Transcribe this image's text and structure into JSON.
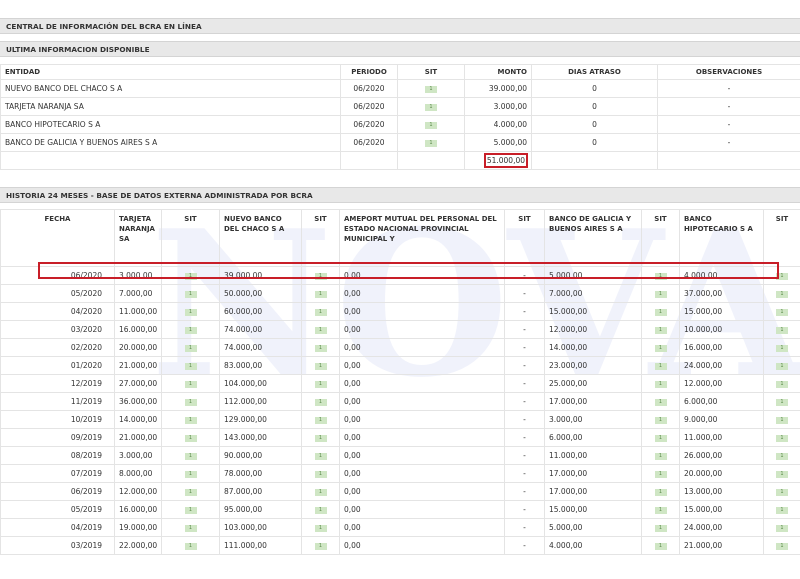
{
  "header_bar": "CENTRAL DE INFORMACIÓN DEL BCRA EN LÍNEA",
  "section1": {
    "title": "ULTIMA INFORMACION DISPONIBLE",
    "columns": [
      "ENTIDAD",
      "PERIODO",
      "SIT",
      "MONTO",
      "DIAS ATRASO",
      "OBSERVACIONES"
    ],
    "rows": [
      {
        "entidad": "NUEVO BANCO DEL CHACO S A",
        "periodo": "06/2020",
        "sit": "1",
        "monto": "39.000,00",
        "dias": "0",
        "obs": "-"
      },
      {
        "entidad": "TARJETA NARANJA SA",
        "periodo": "06/2020",
        "sit": "1",
        "monto": "3.000,00",
        "dias": "0",
        "obs": "-"
      },
      {
        "entidad": "BANCO HIPOTECARIO S A",
        "periodo": "06/2020",
        "sit": "1",
        "monto": "4.000,00",
        "dias": "0",
        "obs": "-"
      },
      {
        "entidad": "BANCO DE GALICIA Y BUENOS AIRES S A",
        "periodo": "06/2020",
        "sit": "1",
        "monto": "5.000,00",
        "dias": "0",
        "obs": "-"
      }
    ],
    "total": "51.000,00"
  },
  "section2": {
    "title": "HISTORIA 24 MESES - BASE DE DATOS EXTERNA ADMINISTRADA POR BCRA",
    "columns": [
      "FECHA",
      "TARJETA NARANJA SA",
      "SIT",
      "NUEVO BANCO DEL CHACO S A",
      "SIT",
      "AMEPORT MUTUAL DEL PERSONAL DEL ESTADO NACIONAL PROVINCIAL MUNICIPAL Y",
      "SIT",
      "BANCO DE GALICIA Y BUENOS AIRES S A",
      "SIT",
      "BANCO HIPOTECARIO S A",
      "SIT"
    ],
    "rows": [
      {
        "fecha": "06/2020",
        "tn": "3.000,00",
        "nbc": "39.000,00",
        "am": "0,00",
        "am_sit": "-",
        "gal": "5.000,00",
        "hip": "4.000,00"
      },
      {
        "fecha": "05/2020",
        "tn": "7.000,00",
        "nbc": "50.000,00",
        "am": "0,00",
        "am_sit": "-",
        "gal": "7.000,00",
        "hip": "37.000,00"
      },
      {
        "fecha": "04/2020",
        "tn": "11.000,00",
        "nbc": "60.000,00",
        "am": "0,00",
        "am_sit": "-",
        "gal": "15.000,00",
        "hip": "15.000,00"
      },
      {
        "fecha": "03/2020",
        "tn": "16.000,00",
        "nbc": "74.000,00",
        "am": "0,00",
        "am_sit": "-",
        "gal": "12.000,00",
        "hip": "10.000,00"
      },
      {
        "fecha": "02/2020",
        "tn": "20.000,00",
        "nbc": "74.000,00",
        "am": "0,00",
        "am_sit": "-",
        "gal": "14.000,00",
        "hip": "16.000,00"
      },
      {
        "fecha": "01/2020",
        "tn": "21.000,00",
        "nbc": "83.000,00",
        "am": "0,00",
        "am_sit": "-",
        "gal": "23.000,00",
        "hip": "24.000,00"
      },
      {
        "fecha": "12/2019",
        "tn": "27.000,00",
        "nbc": "104.000,00",
        "am": "0,00",
        "am_sit": "-",
        "gal": "25.000,00",
        "hip": "12.000,00"
      },
      {
        "fecha": "11/2019",
        "tn": "36.000,00",
        "nbc": "112.000,00",
        "am": "0,00",
        "am_sit": "-",
        "gal": "17.000,00",
        "hip": "6.000,00"
      },
      {
        "fecha": "10/2019",
        "tn": "14.000,00",
        "nbc": "129.000,00",
        "am": "0,00",
        "am_sit": "-",
        "gal": "3.000,00",
        "hip": "9.000,00"
      },
      {
        "fecha": "09/2019",
        "tn": "21.000,00",
        "nbc": "143.000,00",
        "am": "0,00",
        "am_sit": "-",
        "gal": "6.000,00",
        "hip": "11.000,00"
      },
      {
        "fecha": "08/2019",
        "tn": "3.000,00",
        "nbc": "90.000,00",
        "am": "0,00",
        "am_sit": "-",
        "gal": "11.000,00",
        "hip": "26.000,00"
      },
      {
        "fecha": "07/2019",
        "tn": "8.000,00",
        "nbc": "78.000,00",
        "am": "0,00",
        "am_sit": "-",
        "gal": "17.000,00",
        "hip": "20.000,00"
      },
      {
        "fecha": "06/2019",
        "tn": "12.000,00",
        "nbc": "87.000,00",
        "am": "0,00",
        "am_sit": "-",
        "gal": "17.000,00",
        "hip": "13.000,00"
      },
      {
        "fecha": "05/2019",
        "tn": "16.000,00",
        "nbc": "95.000,00",
        "am": "0,00",
        "am_sit": "-",
        "gal": "15.000,00",
        "hip": "15.000,00"
      },
      {
        "fecha": "04/2019",
        "tn": "19.000,00",
        "nbc": "103.000,00",
        "am": "0,00",
        "am_sit": "-",
        "gal": "5.000,00",
        "hip": "24.000,00"
      },
      {
        "fecha": "03/2019",
        "tn": "22.000,00",
        "nbc": "111.000,00",
        "am": "0,00",
        "am_sit": "-",
        "gal": "4.000,00",
        "hip": "21.000,00"
      }
    ],
    "sit_value": "1"
  },
  "watermark": "NOVA",
  "colors": {
    "highlight": "#c81e28",
    "sit_badge": "#cfe6c4",
    "header_bg": "#e8e8e8"
  }
}
